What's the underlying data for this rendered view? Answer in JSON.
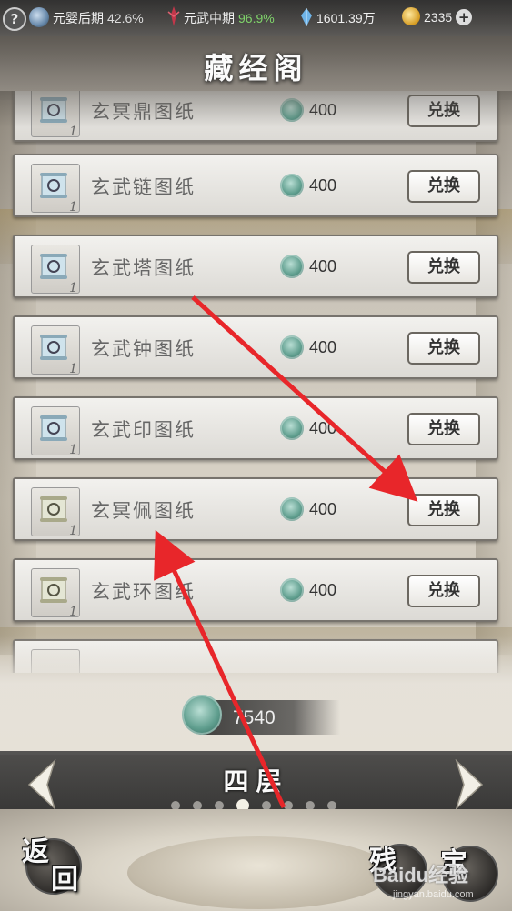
{
  "status_bar": {
    "help_label": "?",
    "realm1": {
      "label": "元婴后期",
      "percent": "42.6%"
    },
    "realm2": {
      "label": "元武中期",
      "percent": "96.9%"
    },
    "spirit_stones": "1601.39万",
    "gold": "2335",
    "add_label": "+"
  },
  "title": "藏经阁",
  "currency_icon": "jade-token-icon",
  "items": [
    {
      "name": "玄冥鼎图纸",
      "count": "1",
      "cost": "400",
      "button": "兑换"
    },
    {
      "name": "玄武链图纸",
      "count": "1",
      "cost": "400",
      "button": "兑换"
    },
    {
      "name": "玄武塔图纸",
      "count": "1",
      "cost": "400",
      "button": "兑换"
    },
    {
      "name": "玄武钟图纸",
      "count": "1",
      "cost": "400",
      "button": "兑换"
    },
    {
      "name": "玄武印图纸",
      "count": "1",
      "cost": "400",
      "button": "兑换"
    },
    {
      "name": "玄冥佩图纸",
      "count": "1",
      "cost": "400",
      "button": "兑换"
    },
    {
      "name": "玄武环图纸",
      "count": "1",
      "cost": "400",
      "button": "兑换"
    },
    {
      "name": "",
      "count": "",
      "cost": "",
      "button": ""
    }
  ],
  "balance": "7540",
  "floor": {
    "label": "四层",
    "pages_total": 8,
    "active_page_index": 3
  },
  "bottom": {
    "back_label_1": "返",
    "back_label_2": "回",
    "left_round_char": "残",
    "right_round_char": "宝"
  },
  "watermark": {
    "text": "Baidu经验",
    "sub": "jingyan.baidu.com"
  },
  "colors": {
    "annotation_arrow": "#e8262a",
    "jade": "#5f9e8e"
  }
}
